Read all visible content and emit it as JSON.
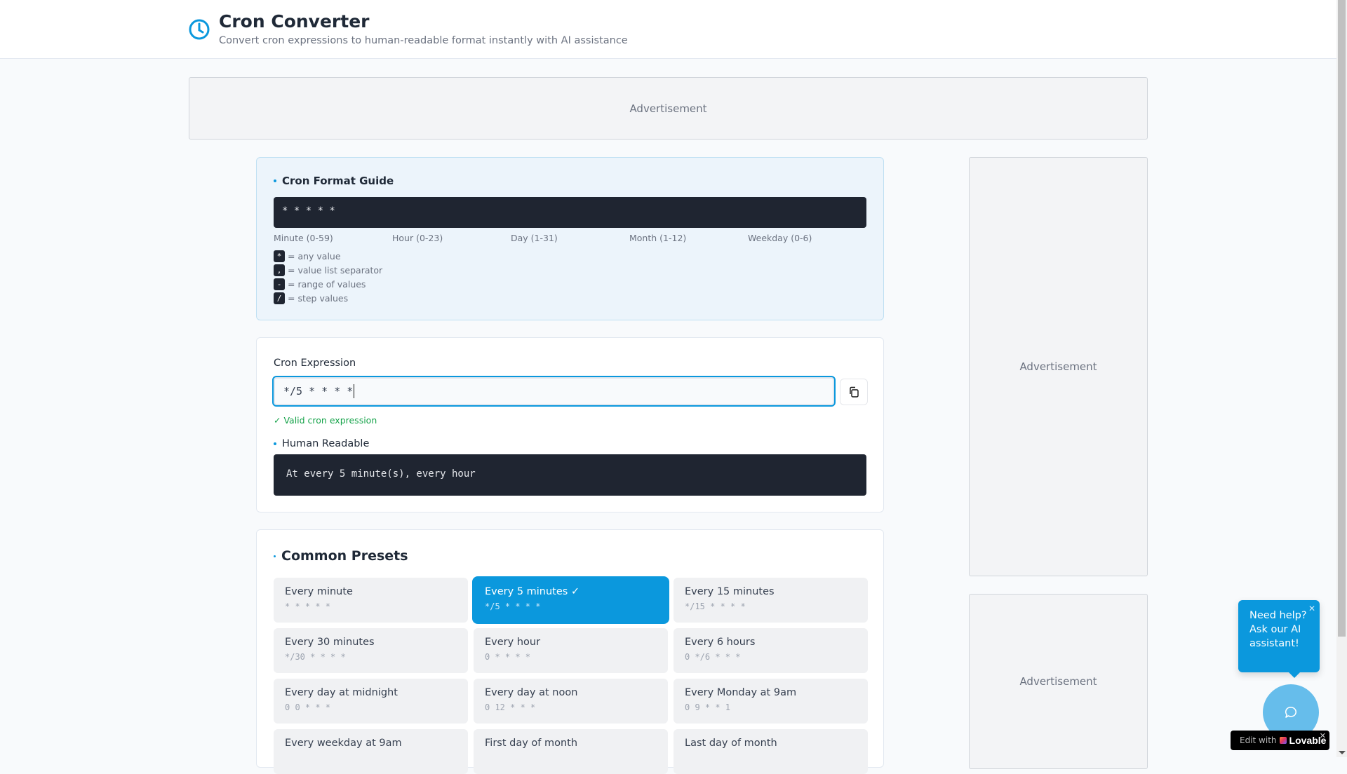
{
  "header": {
    "title": "Cron Converter",
    "subtitle": "Convert cron expressions to human-readable format instantly with AI assistance"
  },
  "ads": {
    "label": "Advertisement"
  },
  "guide": {
    "title": "Cron Format Guide",
    "pattern": "* * * * *",
    "fields": [
      "Minute (0-59)",
      "Hour (0-23)",
      "Day (1-31)",
      "Month (1-12)",
      "Weekday (0-6)"
    ],
    "legend": [
      {
        "key": "*",
        "text": "= any value"
      },
      {
        "key": ",",
        "text": "= value list separator"
      },
      {
        "key": "-",
        "text": "= range of values"
      },
      {
        "key": "/",
        "text": "= step values"
      }
    ]
  },
  "expression": {
    "label": "Cron Expression",
    "value": "*/5 * * * *",
    "valid": "Valid cron expression",
    "readable_label": "Human Readable",
    "readable": "At every 5 minute(s), every hour"
  },
  "presets": {
    "title": "Common Presets",
    "items": [
      {
        "name": "Every minute",
        "cron": "* * * * *"
      },
      {
        "name": "Every 5 minutes ✓",
        "cron": "*/5 * * * *"
      },
      {
        "name": "Every 15 minutes",
        "cron": "*/15 * * * *"
      },
      {
        "name": "Every 30 minutes",
        "cron": "*/30 * * * *"
      },
      {
        "name": "Every hour",
        "cron": "0 * * * *"
      },
      {
        "name": "Every 6 hours",
        "cron": "0 */6 * * *"
      },
      {
        "name": "Every day at midnight",
        "cron": "0 0 * * *"
      },
      {
        "name": "Every day at noon",
        "cron": "0 12 * * *"
      },
      {
        "name": "Every Monday at 9am",
        "cron": "0 9 * * 1"
      },
      {
        "name": "Every weekday at 9am",
        "cron": ""
      },
      {
        "name": "First day of month",
        "cron": ""
      },
      {
        "name": "Last day of month",
        "cron": ""
      }
    ]
  },
  "chat": {
    "tooltip": "Need help? Ask our AI assistant!"
  },
  "badge": {
    "prefix": "Edit with",
    "brand": "Lovable"
  },
  "colors": {
    "accent": "#0b98dd",
    "dark": "#1f2531",
    "valid": "#16a34a"
  }
}
